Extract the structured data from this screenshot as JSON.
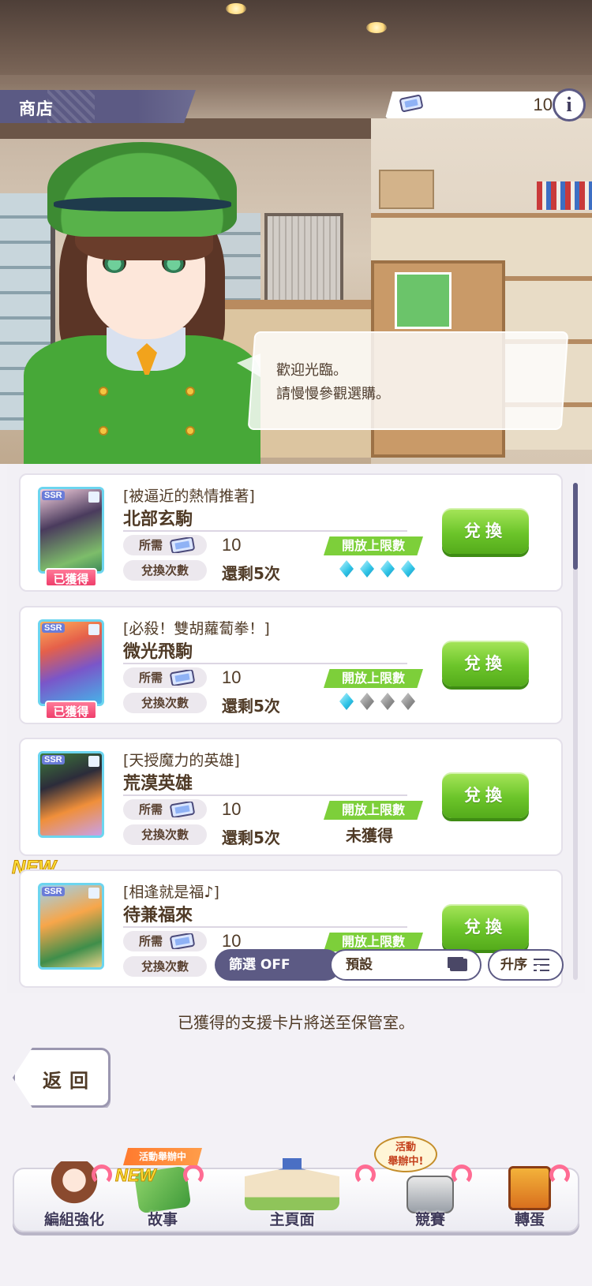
{
  "header": {
    "title": "商店",
    "currency_value": "10",
    "info_label": "i"
  },
  "dialog": {
    "line1": "歡迎光臨。",
    "line2": "請慢慢參觀選購。"
  },
  "labels": {
    "required": "所需",
    "exchange_count": "兌換次數",
    "limit_break": "開放上限數",
    "exchange_button": "兌換",
    "acquired": "已獲得",
    "not_acquired": "未獲得",
    "new": "NEW"
  },
  "items": [
    {
      "event": "[被逼近的熱情推著]",
      "name": "北部玄駒",
      "cost": "10",
      "remaining": "還剩5次",
      "acquired": true,
      "is_new": false,
      "limit_on": 4
    },
    {
      "event": "[必殺！雙胡蘿蔔拳！]",
      "name": "微光飛駒",
      "cost": "10",
      "remaining": "還剩5次",
      "acquired": true,
      "is_new": false,
      "limit_on": 1
    },
    {
      "event": "[天授魔力的英雄]",
      "name": "荒漠英雄",
      "cost": "10",
      "remaining": "還剩5次",
      "acquired": false,
      "is_new": false,
      "limit_on": 0
    },
    {
      "event": "[相逢就是福♪]",
      "name": "待兼福來",
      "cost": "10",
      "remaining": "",
      "acquired": false,
      "is_new": true,
      "limit_on": 0
    }
  ],
  "toolbar": {
    "filter_label": "篩選 OFF",
    "preset_label": "預設",
    "sort_label": "升序"
  },
  "notice": "已獲得的支援卡片將送至保管室。",
  "back_label": "返回",
  "nav": {
    "items": [
      {
        "label": "編組強化"
      },
      {
        "label": "故事"
      },
      {
        "label": "主頁面"
      },
      {
        "label": "競賽"
      },
      {
        "label": "轉蛋"
      }
    ],
    "event_badge": "活動舉辦中",
    "event_bubble_1": "活動",
    "event_bubble_2": "舉辦中!",
    "story_new": "NEW"
  },
  "colors": {
    "accent_purple": "#5c5a84",
    "button_green": "#6cc52a",
    "diamond_on": "#2ec3e6",
    "diamond_off": "#8e8e8e",
    "acquired_pink": "#ef3d6b"
  },
  "icons": {
    "currency": "ticket-icon",
    "info": "info-icon",
    "preset": "stack-icon",
    "sort": "sort-icon"
  }
}
